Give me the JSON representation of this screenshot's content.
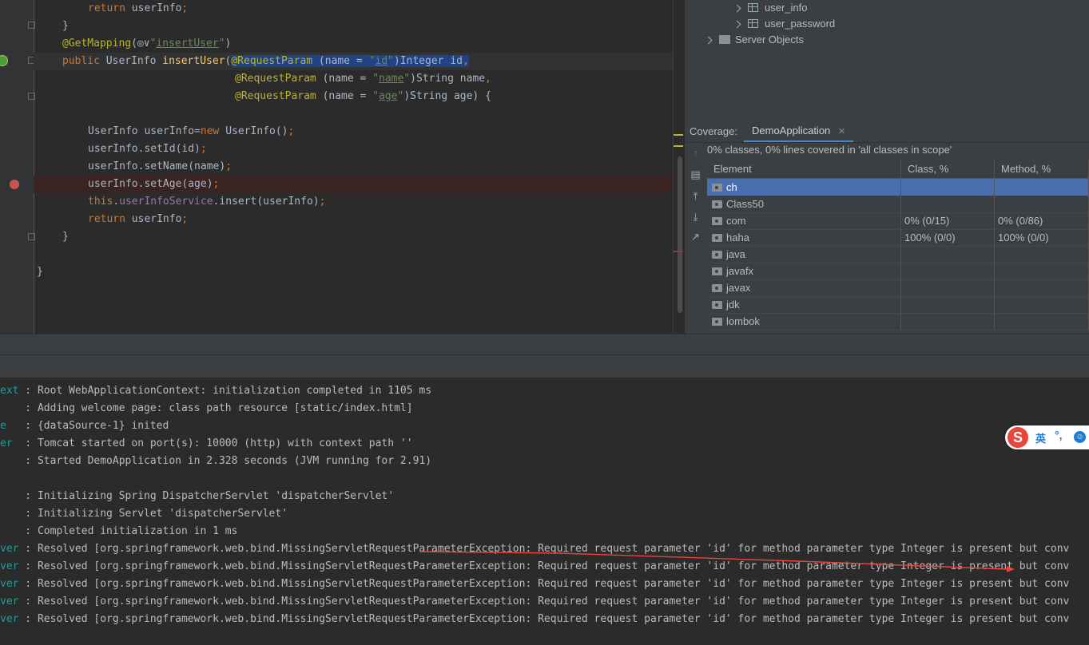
{
  "editor": {
    "lines": [
      {
        "parts": [
          [
            "kw",
            "return "
          ],
          [
            "",
            "userInfo"
          ],
          [
            "kw",
            ";"
          ]
        ]
      },
      {
        "parts": [
          [
            "",
            "}"
          ]
        ]
      },
      {
        "parts": [
          [
            "ann",
            "@GetMapping"
          ],
          [
            "",
            "("
          ],
          [
            "",
            "◎∨"
          ],
          [
            "str",
            "\""
          ],
          [
            "str ul",
            "insertUser"
          ],
          [
            "str",
            "\""
          ],
          [
            "",
            ")"
          ]
        ]
      },
      {
        "parts": [
          [
            "kw",
            "public "
          ],
          [
            "",
            "UserInfo "
          ],
          [
            "fn",
            "insertUser"
          ],
          [
            "",
            "("
          ],
          [
            "ann sel",
            "@RequestParam"
          ],
          [
            "sel",
            " (name = "
          ],
          [
            "str sel",
            "\""
          ],
          [
            "str sel ul",
            "id"
          ],
          [
            "str sel",
            "\""
          ],
          [
            "sel",
            ")Integer id"
          ],
          [
            "kw sel",
            ","
          ]
        ]
      },
      {
        "parts": [
          [
            "ann",
            "@RequestParam"
          ],
          [
            "",
            " (name = "
          ],
          [
            "str",
            "\""
          ],
          [
            "str ul",
            "name"
          ],
          [
            "str",
            "\""
          ],
          [
            "",
            ")String name"
          ],
          [
            "kw",
            ","
          ]
        ]
      },
      {
        "parts": [
          [
            "ann",
            "@RequestParam"
          ],
          [
            "",
            " (name = "
          ],
          [
            "str",
            "\""
          ],
          [
            "str ul",
            "age"
          ],
          [
            "str",
            "\""
          ],
          [
            "",
            ")String age) {"
          ]
        ]
      },
      {
        "parts": []
      },
      {
        "parts": [
          [
            "",
            "UserInfo userInfo="
          ],
          [
            "kw",
            "new "
          ],
          [
            "",
            "UserInfo()"
          ],
          [
            "kw",
            ";"
          ]
        ]
      },
      {
        "parts": [
          [
            "",
            "userInfo.setId(id)"
          ],
          [
            "kw",
            ";"
          ]
        ]
      },
      {
        "parts": [
          [
            "",
            "userInfo.setName(name)"
          ],
          [
            "kw",
            ";"
          ]
        ]
      },
      {
        "parts": [
          [
            "",
            "userInfo.setAge(age)"
          ],
          [
            "kw",
            ";"
          ]
        ]
      },
      {
        "parts": [
          [
            "kw",
            "this"
          ],
          [
            "",
            "."
          ],
          [
            "fld",
            "userInfoService"
          ],
          [
            "",
            ".insert(userInfo)"
          ],
          [
            "kw",
            ";"
          ]
        ]
      },
      {
        "parts": [
          [
            "kw",
            "return "
          ],
          [
            "",
            "userInfo"
          ],
          [
            "kw",
            ";"
          ]
        ]
      },
      {
        "parts": [
          [
            "",
            "}"
          ]
        ]
      },
      {
        "parts": []
      },
      {
        "parts": [
          [
            "",
            "}"
          ]
        ]
      }
    ]
  },
  "db_tree": {
    "items": [
      {
        "label": "user_info"
      },
      {
        "label": "user_password"
      },
      {
        "label": "Server Objects"
      }
    ]
  },
  "coverage": {
    "label": "Coverage:",
    "tab": "DemoApplication",
    "summary": "0% classes, 0% lines covered in 'all classes in scope'",
    "columns": [
      "Element",
      "Class, %",
      "Method, %"
    ],
    "rows": [
      {
        "name": "ch",
        "class": "",
        "method": ""
      },
      {
        "name": "Class50",
        "class": "",
        "method": ""
      },
      {
        "name": "com",
        "class": "0% (0/15)",
        "method": "0% (0/86)"
      },
      {
        "name": "haha",
        "class": "100% (0/0)",
        "method": "100% (0/0)"
      },
      {
        "name": "java",
        "class": "",
        "method": ""
      },
      {
        "name": "javafx",
        "class": "",
        "method": ""
      },
      {
        "name": "javax",
        "class": "",
        "method": ""
      },
      {
        "name": "jdk",
        "class": "",
        "method": ""
      },
      {
        "name": "lombok",
        "class": "",
        "method": ""
      }
    ]
  },
  "console": {
    "lines": [
      {
        "prefix": "ext",
        "text": " : Root WebApplicationContext: initialization completed in 1105 ms"
      },
      {
        "prefix": "   ",
        "text": " : Adding welcome page: class path resource [static/index.html]"
      },
      {
        "prefix": "e  ",
        "text": " : {dataSource-1} inited"
      },
      {
        "prefix": "er ",
        "text": " : Tomcat started on port(s): 10000 (http) with context path ''"
      },
      {
        "prefix": "   ",
        "text": " : Started DemoApplication in 2.328 seconds (JVM running for 2.91)"
      },
      {
        "prefix": "",
        "text": ""
      },
      {
        "prefix": "   ",
        "text": " : Initializing Spring DispatcherServlet 'dispatcherServlet'"
      },
      {
        "prefix": "   ",
        "text": " : Initializing Servlet 'dispatcherServlet'"
      },
      {
        "prefix": "   ",
        "text": " : Completed initialization in 1 ms"
      },
      {
        "prefix": "ver",
        "text": " : Resolved [org.springframework.web.bind.MissingServletRequestParameterException: Required request parameter 'id' for method parameter type Integer is present but conv"
      },
      {
        "prefix": "ver",
        "text": " : Resolved [org.springframework.web.bind.MissingServletRequestParameterException: Required request parameter 'id' for method parameter type Integer is present but conv"
      },
      {
        "prefix": "ver",
        "text": " : Resolved [org.springframework.web.bind.MissingServletRequestParameterException: Required request parameter 'id' for method parameter type Integer is present but conv"
      },
      {
        "prefix": "ver",
        "text": " : Resolved [org.springframework.web.bind.MissingServletRequestParameterException: Required request parameter 'id' for method parameter type Integer is present but conv"
      },
      {
        "prefix": "ver",
        "text": " : Resolved [org.springframework.web.bind.MissingServletRequestParameterException: Required request parameter 'id' for method parameter type Integer is present but conv"
      }
    ]
  },
  "ime": {
    "logo": "S",
    "mode": "英",
    "punct": "°,"
  },
  "colors": {
    "accent": "#4b6eaf",
    "breakpoint": "#c75450",
    "annotation": "#e8453c"
  }
}
